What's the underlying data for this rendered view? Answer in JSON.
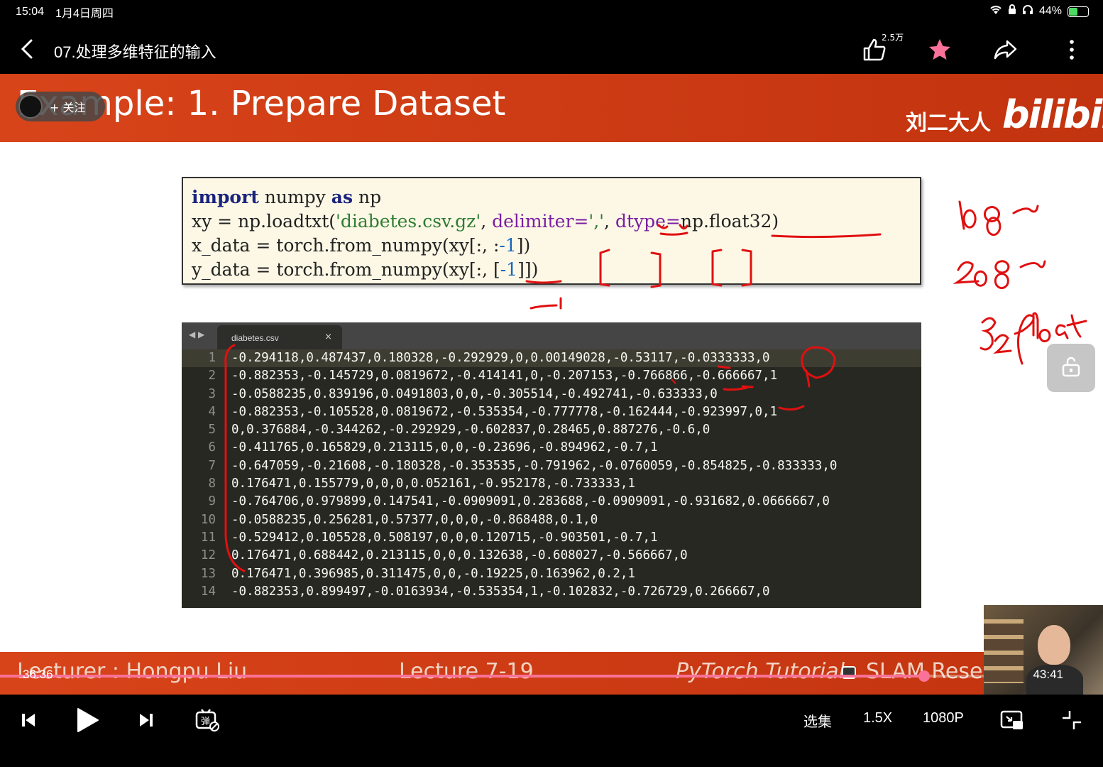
{
  "status_bar": {
    "time": "15:04",
    "date": "1月4日周四",
    "battery": "44%"
  },
  "nav": {
    "title": "07.处理多维特征的输入",
    "like_count": "2.5万"
  },
  "slide": {
    "title": "Example: 1. Prepare Dataset",
    "follow_label": "+ 关注",
    "uploader": "刘二大人",
    "platform_logo": "bilibili",
    "code_lines": [
      [
        {
          "t": "import",
          "c": "kw"
        },
        {
          "t": " numpy ",
          "c": ""
        },
        {
          "t": "as",
          "c": "kw"
        },
        {
          "t": " np",
          "c": ""
        }
      ],
      [
        {
          "t": "xy = np.loadtxt(",
          "c": ""
        },
        {
          "t": "'diabetes.csv.gz'",
          "c": "str"
        },
        {
          "t": ", ",
          "c": ""
        },
        {
          "t": "delimiter=",
          "c": "arg"
        },
        {
          "t": "','",
          "c": "str"
        },
        {
          "t": ", ",
          "c": ""
        },
        {
          "t": "dtype=",
          "c": "arg"
        },
        {
          "t": "np.float32)",
          "c": ""
        }
      ],
      [
        {
          "t": "x_data = torch.from_numpy(xy[:, :",
          "c": ""
        },
        {
          "t": "-1",
          "c": "num"
        },
        {
          "t": "])",
          "c": ""
        }
      ],
      [
        {
          "t": "y_data = torch.from_numpy(xy[:, [",
          "c": ""
        },
        {
          "t": "-1",
          "c": "num"
        },
        {
          "t": "]])",
          "c": ""
        }
      ]
    ],
    "editor": {
      "tab_name": "diabetes.csv",
      "tab_close": "×",
      "nav_arrows": "◀ ▶",
      "lines": [
        {
          "n": "1",
          "text": "-0.294118,0.487437,0.180328,-0.292929,0,0.00149028,-0.53117,-0.0333333,0"
        },
        {
          "n": "2",
          "text": "-0.882353,-0.145729,0.0819672,-0.414141,0,-0.207153,-0.766866,-0.666667,1"
        },
        {
          "n": "3",
          "text": "-0.0588235,0.839196,0.0491803,0,0,-0.305514,-0.492741,-0.633333,0"
        },
        {
          "n": "4",
          "text": "-0.882353,-0.105528,0.0819672,-0.535354,-0.777778,-0.162444,-0.923997,0,1"
        },
        {
          "n": "5",
          "text": "0,0.376884,-0.344262,-0.292929,-0.602837,0.28465,0.887276,-0.6,0"
        },
        {
          "n": "6",
          "text": "-0.411765,0.165829,0.213115,0,0,-0.23696,-0.894962,-0.7,1"
        },
        {
          "n": "7",
          "text": "-0.647059,-0.21608,-0.180328,-0.353535,-0.791962,-0.0760059,-0.854825,-0.833333,0"
        },
        {
          "n": "8",
          "text": "0.176471,0.155779,0,0,0,0.052161,-0.952178,-0.733333,1"
        },
        {
          "n": "9",
          "text": "-0.764706,0.979899,0.147541,-0.0909091,0.283688,-0.0909091,-0.931682,0.0666667,0"
        },
        {
          "n": "10",
          "text": "-0.0588235,0.256281,0.57377,0,0,0,-0.868488,0.1,0"
        },
        {
          "n": "11",
          "text": "-0.529412,0.105528,0.508197,0,0,0.120715,-0.903501,-0.7,1"
        },
        {
          "n": "12",
          "text": "0.176471,0.688442,0.213115,0,0,0.132638,-0.608027,-0.566667,0"
        },
        {
          "n": "13",
          "text": "0.176471,0.396985,0.311475,0,0,-0.19225,0.163962,0.2,1"
        },
        {
          "n": "14",
          "text": "-0.882353,0.899497,-0.0163934,-0.535354,1,-0.102832,-0.726729,0.266667,0"
        }
      ]
    },
    "footer": {
      "lecturer": "Lecturer : Hongpu Liu",
      "lecture": "Lecture 7-19",
      "tutorial": "PyTorch Tutorial",
      "slam": "SLAM Resea"
    }
  },
  "playback": {
    "current_time": "36:36",
    "total_time": "43:41",
    "progress": 0.838
  },
  "controls": {
    "episodes": "选集",
    "speed": "1.5X",
    "quality": "1080P"
  },
  "colors": {
    "accent": "#fb7299",
    "banner": "#d8441a",
    "ink": "#e01010"
  }
}
